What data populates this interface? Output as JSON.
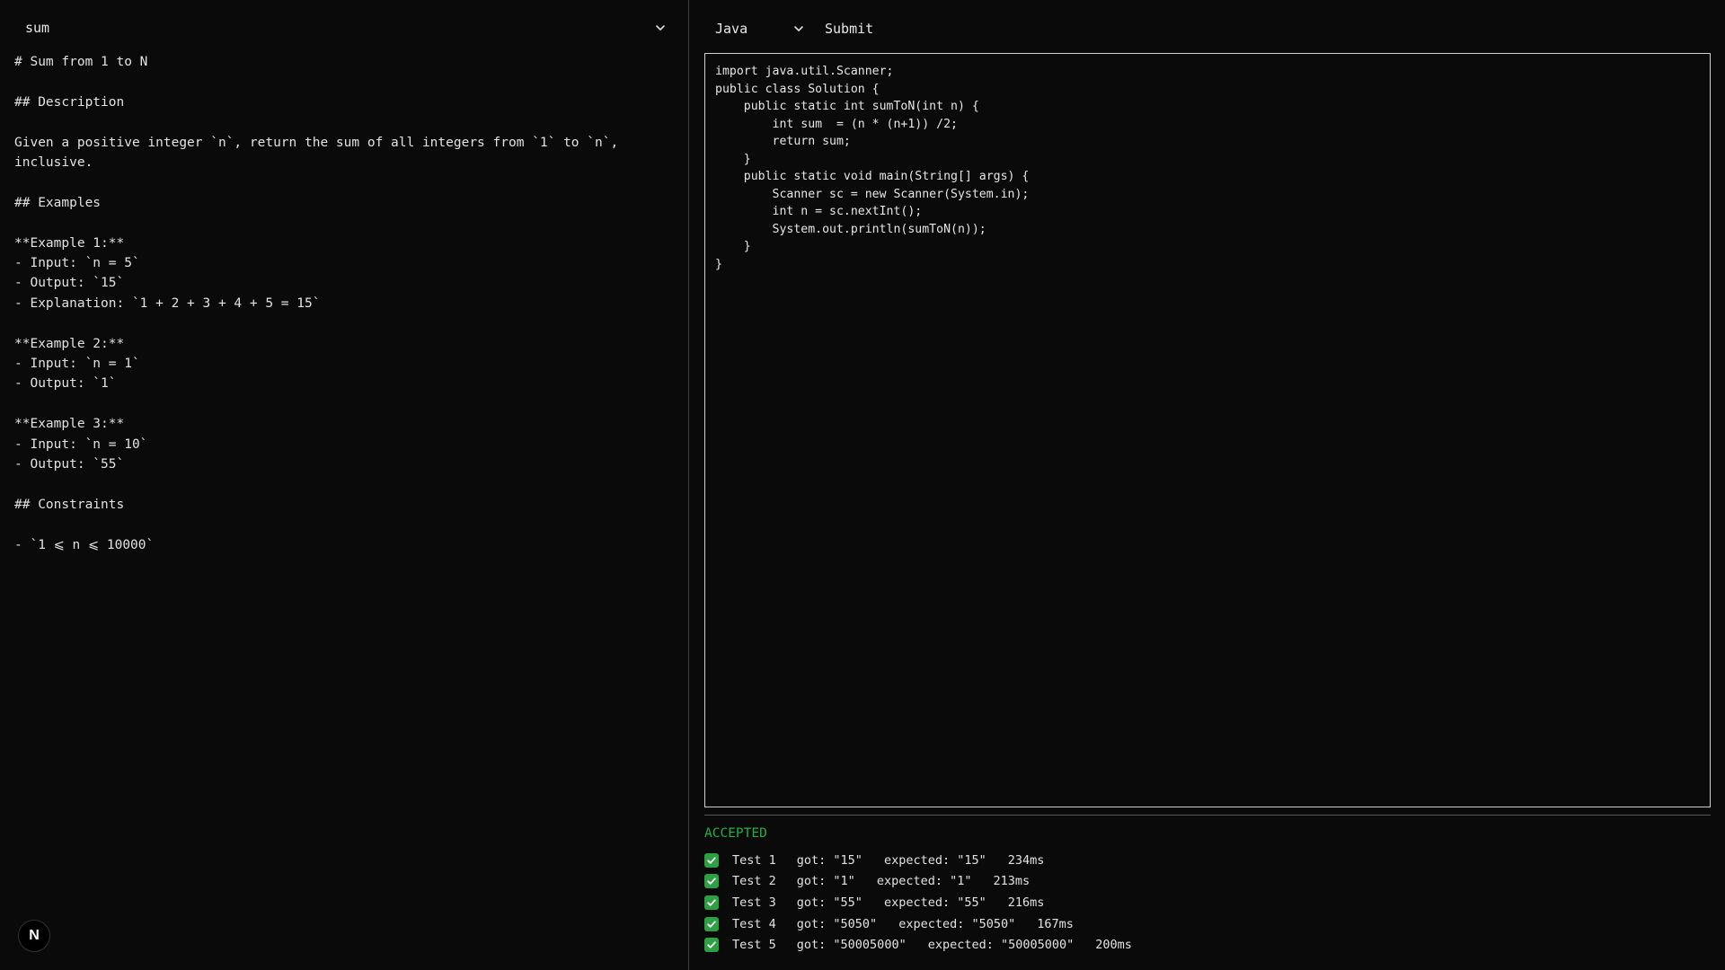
{
  "problem_select": {
    "value": "sum"
  },
  "description_lines": [
    "# Sum from 1 to N",
    "",
    "## Description",
    "",
    "Given a positive integer `n`, return the sum of all integers from `1` to `n`,",
    "inclusive.",
    "",
    "## Examples",
    "",
    "**Example 1:**",
    "- Input: `n = 5`",
    "- Output: `15`",
    "- Explanation: `1 + 2 + 3 + 4 + 5 = 15`",
    "",
    "**Example 2:**",
    "- Input: `n = 1`",
    "- Output: `1`",
    "",
    "**Example 3:**",
    "- Input: `n = 10`",
    "- Output: `55`",
    "",
    "## Constraints",
    "",
    "- `1 ⩽ n ⩽ 10000`"
  ],
  "logo": {
    "letter": "N"
  },
  "toolbar": {
    "language": "Java",
    "submit_label": "Submit"
  },
  "code_lines": [
    "import java.util.Scanner;",
    "public class Solution {",
    "    public static int sumToN(int n) {",
    "        int sum  = (n * (n+1)) /2;",
    "        return sum;",
    "    }",
    "    public static void main(String[] args) {",
    "        Scanner sc = new Scanner(System.in);",
    "        int n = sc.nextInt();",
    "        System.out.println(sumToN(n));",
    "    }",
    "}"
  ],
  "verdict": "ACCEPTED",
  "colors": {
    "accepted": "#1fb141",
    "check_bg": "#2ea043"
  },
  "results": [
    {
      "name": "Test 1",
      "got": "got: \"15\"",
      "expected": "expected: \"15\"",
      "time": "234ms"
    },
    {
      "name": "Test 2",
      "got": "got: \"1\"",
      "expected": "expected: \"1\"",
      "time": "213ms"
    },
    {
      "name": "Test 3",
      "got": "got: \"55\"",
      "expected": "expected: \"55\"",
      "time": "216ms"
    },
    {
      "name": "Test 4",
      "got": "got: \"5050\"",
      "expected": "expected: \"5050\"",
      "time": "167ms"
    },
    {
      "name": "Test 5",
      "got": "got: \"50005000\"",
      "expected": "expected: \"50005000\"",
      "time": "200ms"
    }
  ]
}
